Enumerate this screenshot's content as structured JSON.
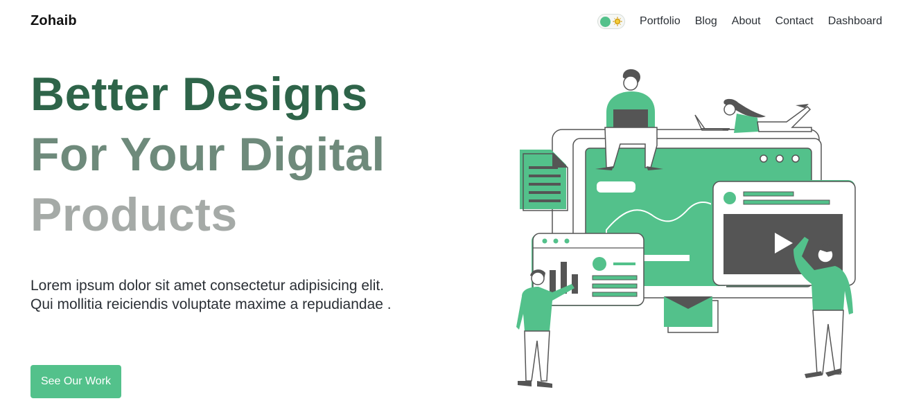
{
  "brand": "Zohaib",
  "nav": {
    "theme_toggle_icon": "sun-icon",
    "items": [
      "Portfolio",
      "Blog",
      "About",
      "Contact",
      "Dashboard"
    ]
  },
  "hero": {
    "title_line1": "Better Designs",
    "title_line2": "For Your Digital",
    "title_line3": "Products",
    "description": "Lorem ipsum dolor sit amet consectetur adipisicing elit. Qui mollitia reiciendis voluptate maxime a repudiandae .",
    "cta_label": "See Our Work"
  },
  "colors": {
    "accent": "#53c18b",
    "title_line1": "#2e6449",
    "title_line2": "#6e8a7b",
    "title_line3": "#a5aaa7",
    "dark": "#555555"
  }
}
